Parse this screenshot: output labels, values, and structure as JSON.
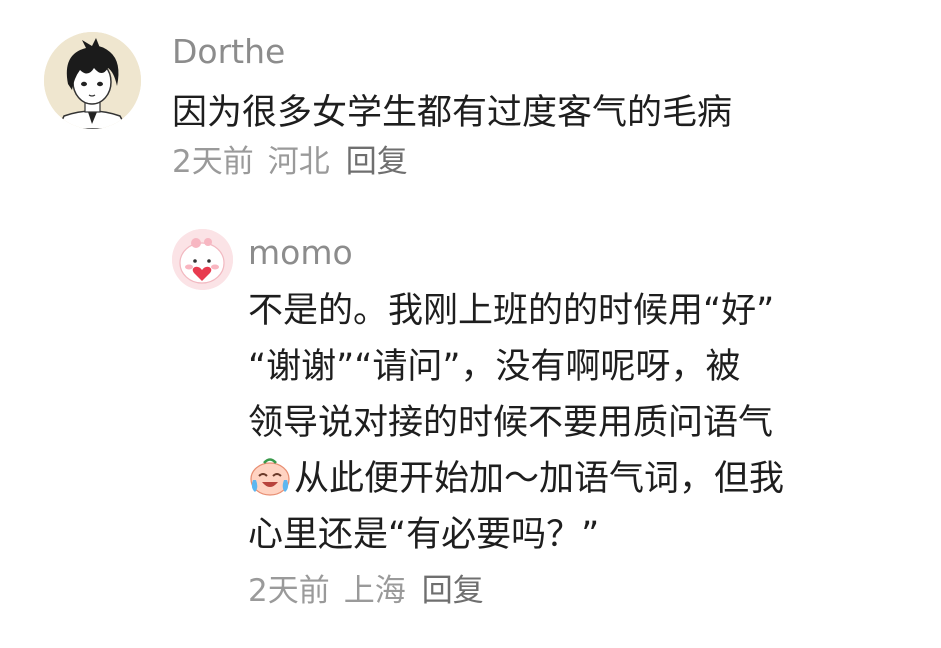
{
  "comments": [
    {
      "username": "Dorthe",
      "text": "因为很多女学生都有过度客气的毛病",
      "time": "2天前",
      "location": "河北",
      "reply_label": "回复"
    },
    {
      "username": "momo",
      "lines": [
        "不是的。我刚上班的的时候用“好”",
        "“谢谢”“请问”，没有啊呢呀，被",
        "领导说对接的时候不要用质问语气",
        "从此便开始加～加语气词，但我",
        "心里还是“有必要吗？”"
      ],
      "emoji": "crying-laughing-emoji",
      "time": "2天前",
      "location": "上海",
      "reply_label": "回复"
    }
  ]
}
